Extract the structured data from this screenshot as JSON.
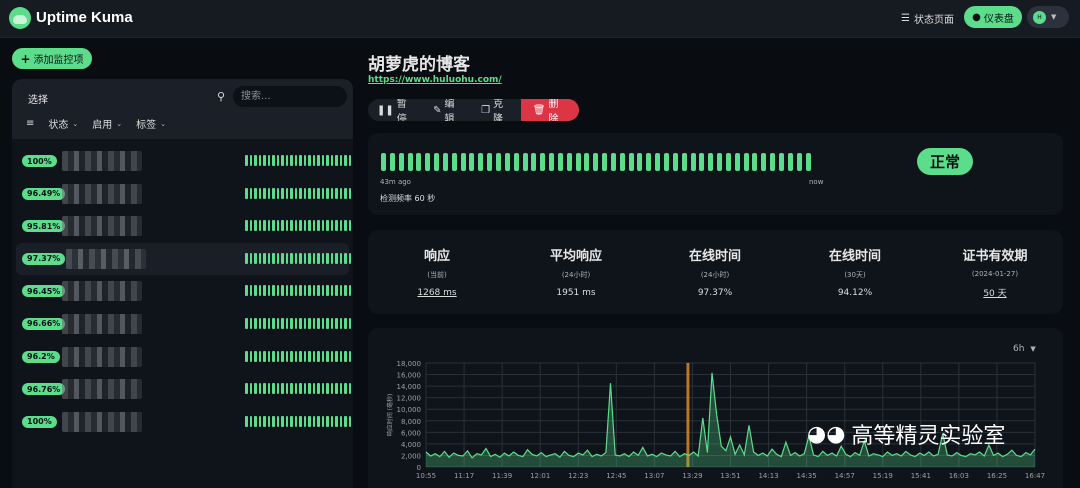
{
  "header": {
    "app_title": "Uptime Kuma",
    "status_page_label": "状态页面",
    "dashboard_label": "仪表盘",
    "avatar_text": "H",
    "accent_color": "#5cdd8b"
  },
  "sidebar": {
    "add_button_label": "添加监控项",
    "select_label": "选择",
    "search_placeholder": "搜索...",
    "filters": [
      "状态",
      "启用",
      "标签"
    ],
    "monitors": [
      {
        "uptime": "100%"
      },
      {
        "uptime": "96.49%"
      },
      {
        "uptime": "95.81%"
      },
      {
        "uptime": "97.37%"
      },
      {
        "uptime": "96.45%"
      },
      {
        "uptime": "96.66%"
      },
      {
        "uptime": "96.2%"
      },
      {
        "uptime": "96.76%"
      },
      {
        "uptime": "100%"
      }
    ]
  },
  "monitor": {
    "title": "胡萝虎的博客",
    "url": "https://www.huluohu.com/",
    "actions": {
      "pause": "暂停",
      "edit": "编辑",
      "clone": "克隆",
      "delete": "删除"
    },
    "beats_start": "43m ago",
    "beats_end": "now",
    "check_interval": "检测频率 60 秒",
    "status": "正常"
  },
  "stats": [
    {
      "title": "响应",
      "sub": "(当前)",
      "value": "1268 ms"
    },
    {
      "title": "平均响应",
      "sub": "(24小时)",
      "value": "1951 ms"
    },
    {
      "title": "在线时间",
      "sub": "(24小时)",
      "value": "97.37%"
    },
    {
      "title": "在线时间",
      "sub": "(30天)",
      "value": "94.12%"
    },
    {
      "title": "证书有效期",
      "sub": "(2024-01-27)",
      "value": "50 天"
    }
  ],
  "chart_range": "6h",
  "chart_data": {
    "type": "line",
    "ylabel": "响应时间 (毫秒)",
    "ylim": [
      0,
      18000
    ],
    "yticks": [
      "0",
      "2,000",
      "4,000",
      "6,000",
      "8,000",
      "10,000",
      "12,000",
      "14,000",
      "16,000",
      "18,000"
    ],
    "xticks": [
      "10:55",
      "11:17",
      "11:39",
      "12:01",
      "12:23",
      "12:45",
      "13:07",
      "13:29",
      "13:51",
      "14:13",
      "14:35",
      "14:57",
      "15:19",
      "15:41",
      "16:03",
      "16:25",
      "16:47"
    ],
    "grid": true,
    "series": [
      {
        "color": "#5cdd8b",
        "values": [
          2600,
          1900,
          2300,
          1800,
          2700,
          1700,
          2400,
          2000,
          1900,
          2800,
          1600,
          2300,
          2100,
          3200,
          1800,
          2200,
          1700,
          2400,
          1900,
          2600,
          2000,
          1800,
          3000,
          2200,
          1900,
          2500,
          1800,
          2100,
          2300,
          1700,
          2700,
          2000,
          1800,
          2400,
          2100,
          2900,
          1800,
          2200,
          1900,
          2500,
          14500,
          2100,
          1900,
          2300,
          1800,
          2600,
          2000,
          3400,
          1900,
          2200,
          1800,
          2400,
          2100,
          1900,
          2700,
          1800,
          2300,
          2000,
          2600,
          1900,
          8500,
          2500,
          16300,
          9000,
          3600,
          2800,
          5200,
          2200,
          3800,
          2100,
          7200,
          2600,
          2000,
          2400,
          1900,
          3100,
          2200,
          1800,
          4300,
          2000,
          2500,
          1900,
          2300,
          5400,
          2100,
          1800,
          2700,
          2000,
          2400,
          1900,
          3600,
          2200,
          1800,
          2500,
          2000,
          4500,
          1900,
          2300,
          2100,
          1800,
          2600,
          2000,
          2300,
          1900,
          2700,
          2100,
          1800,
          2400,
          2000,
          2600,
          1900,
          2200,
          5800,
          2100,
          1900,
          2500,
          2000,
          1800,
          2300,
          2100,
          2600,
          1900,
          3800,
          2000,
          2400,
          1800,
          2200,
          2900,
          2000,
          1800,
          2500,
          2100,
          3100
        ]
      }
    ],
    "incident_markers": [
      "13:29"
    ]
  },
  "watermark": "高等精灵实验室"
}
